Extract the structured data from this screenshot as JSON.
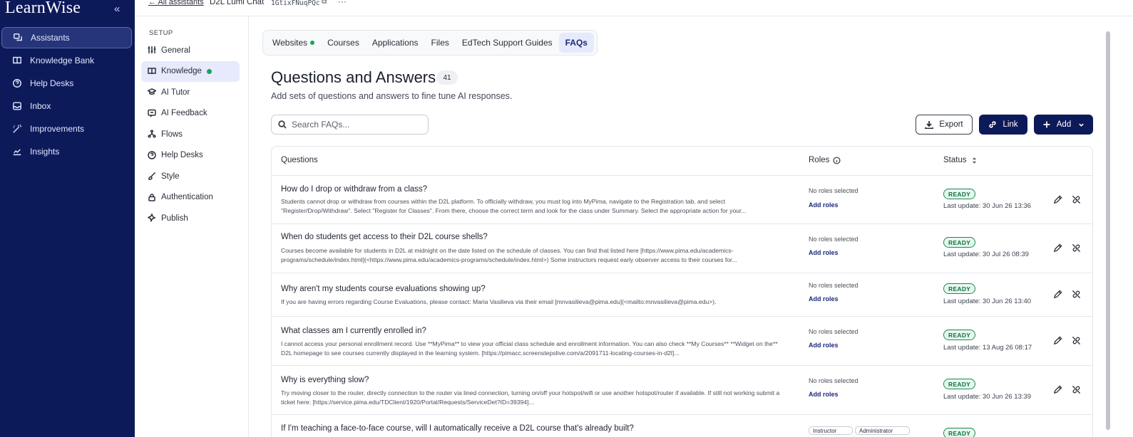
{
  "brand": "LearnWise",
  "nav": [
    {
      "label": "Assistants",
      "icon": "assistants-icon",
      "active": true
    },
    {
      "label": "Knowledge Bank",
      "icon": "book-icon"
    },
    {
      "label": "Help Desks",
      "icon": "help-circle-icon"
    },
    {
      "label": "Inbox",
      "icon": "inbox-icon"
    },
    {
      "label": "Improvements",
      "icon": "wand-icon"
    },
    {
      "label": "Insights",
      "icon": "chart-line-icon"
    }
  ],
  "topbar": {
    "back": "All assistants",
    "title": "D2L Lumi Chat",
    "assistant_id": "1GtixFNuqPQc"
  },
  "settings": {
    "section": "SETUP",
    "items": [
      {
        "label": "General",
        "icon": "sliders-icon"
      },
      {
        "label": "Knowledge",
        "icon": "book-open-icon",
        "active": true
      },
      {
        "label": "AI Tutor",
        "icon": "graduation-cap-icon"
      },
      {
        "label": "AI Feedback",
        "icon": "feedback-icon"
      },
      {
        "label": "Flows",
        "icon": "flows-icon"
      },
      {
        "label": "Help Desks",
        "icon": "help-circle-icon"
      },
      {
        "label": "Style",
        "icon": "brush-icon"
      },
      {
        "label": "Authentication",
        "icon": "lock-icon"
      },
      {
        "label": "Publish",
        "icon": "publish-icon"
      }
    ]
  },
  "tabs": [
    "Websites",
    "Courses",
    "Applications",
    "Files",
    "EdTech Support Guides",
    "FAQs"
  ],
  "page": {
    "title": "Questions and Answers",
    "count": "41",
    "subtitle": "Add sets of questions and answers to fine tune AI responses.",
    "search_placeholder": "Search FAQs..."
  },
  "buttons": {
    "export": "Export",
    "link": "Link",
    "add": "Add"
  },
  "table": {
    "headers": {
      "questions": "Questions",
      "roles": "Roles",
      "status": "Status"
    },
    "no_roles": "No roles selected",
    "add_roles": "Add roles",
    "rows": [
      {
        "question": "How do I drop or withdraw from a class?",
        "answer": "Students cannot drop or withdraw from courses within the D2L platform. To officially withdraw, you must log into MyPima, navigate to the Registration tab, and select \"Register/Drop/Withdraw\". Select \"Register for Classes\". From there, choose the correct term and look for the class under Summary. Select the appropriate action for your...",
        "status": "READY",
        "last_update": "Last update: 30 Jun 26 13:36"
      },
      {
        "question": "When do students get access to their D2L course shells?",
        "answer": "Courses become available for students in D2L at midnight on the date listed on the schedule of classes. You can find that listed here [https://www.pima.edu/academics-programs/schedule/index.html](<https://www.pima.edu/academics-programs/schedule/index.html>) Some instructors request early observer access to their courses for...",
        "status": "READY",
        "last_update": "Last update: 30 Jul 26 08:39"
      },
      {
        "question": "Why aren't my students course evaluations showing up?",
        "answer": "If you are having errors regarding Course Evaluations, please contact: Maria Vasilieva via their email [mnvasilieva@pima.edu](<mailto:mnvasilieva@pima.edu>).",
        "status": "READY",
        "last_update": "Last update: 30 Jun 26 13:40"
      },
      {
        "question": "What classes am I currently enrolled in?",
        "answer": "I cannot access your personal enrollment record. Use **MyPima** to view your official class schedule and enrollment information. You can also check **My Courses** **Widget on the** D2L homepage to see courses currently displayed in the learning system. [https://pimacc.screenstepslive.com/a/2091711-locating-courses-in-d2l]...",
        "status": "READY",
        "last_update": "Last update: 13 Aug 26 08:17"
      },
      {
        "question": "Why is everything slow?",
        "answer": "Try moving closer to the router, directly connection to the router via lined connection, turning on/off your hotspot/wifi or use another hotspot/router if available. If still not working submit a ticket here: [https://service.pima.edu/TDClient/1920/Portal/Requests/ServiceDet?ID=39394]...",
        "status": "READY",
        "last_update": "Last update: 30 Jun 26 13:39"
      },
      {
        "question": "If I'm teaching a face-to-face course, will I automatically receive a D2L course that's already built?",
        "answer": "",
        "role_pills": [
          "Instructor",
          "Administrator"
        ],
        "status": "READY",
        "last_update": ""
      }
    ]
  },
  "colors": {
    "sidebar": "#0d1a5a",
    "accent": "#0d1a5a",
    "ready_green": "#14703f",
    "dot_green": "#18a35a",
    "active_tab": "#e6eafc"
  }
}
